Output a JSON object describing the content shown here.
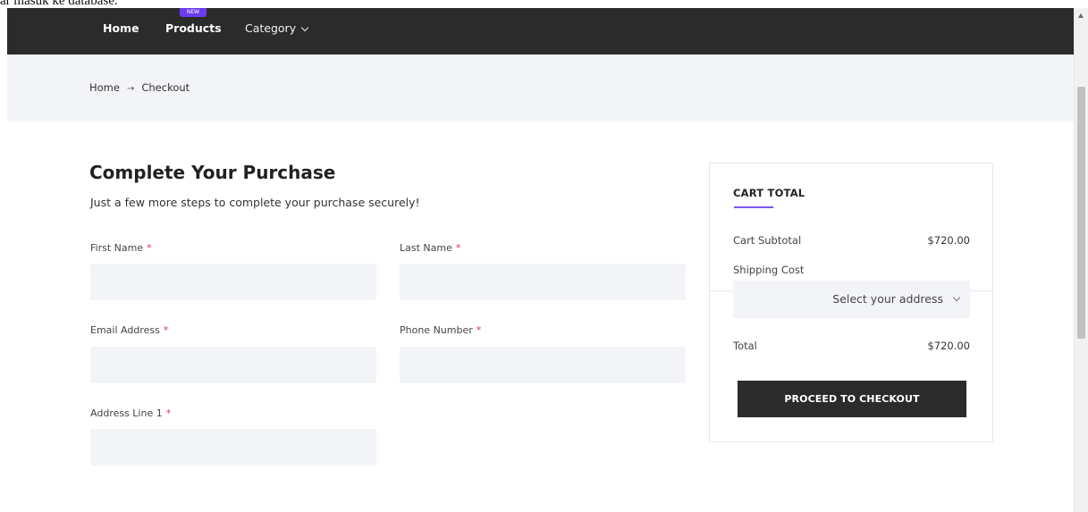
{
  "top_text": "ar masuk ke database.",
  "nav": {
    "home": "Home",
    "products": "Products",
    "products_badge": "NEW",
    "category": "Category"
  },
  "breadcrumb": {
    "home": "Home",
    "separator": "→",
    "current": "Checkout"
  },
  "form": {
    "title": "Complete Your Purchase",
    "subtitle": "Just a few more steps to complete your purchase securely!",
    "required_marker": "*",
    "fields": {
      "first_name": {
        "label": "First Name",
        "value": ""
      },
      "last_name": {
        "label": "Last Name",
        "value": ""
      },
      "email": {
        "label": "Email Address",
        "value": ""
      },
      "phone": {
        "label": "Phone Number",
        "value": ""
      },
      "address1": {
        "label": "Address Line 1",
        "value": ""
      }
    }
  },
  "cart": {
    "title": "CART TOTAL",
    "subtotal_label": "Cart Subtotal",
    "subtotal_value": "$720.00",
    "shipping_label": "Shipping Cost",
    "address_select": "Select your address",
    "total_label": "Total",
    "total_value": "$720.00",
    "checkout_button": "PROCEED TO CHECKOUT"
  },
  "colors": {
    "navbar": "#2b2b2b",
    "accent": "#7b55f0",
    "badge": "#6b3cf0",
    "required": "#e0344a",
    "input_bg": "#f3f4f7"
  }
}
